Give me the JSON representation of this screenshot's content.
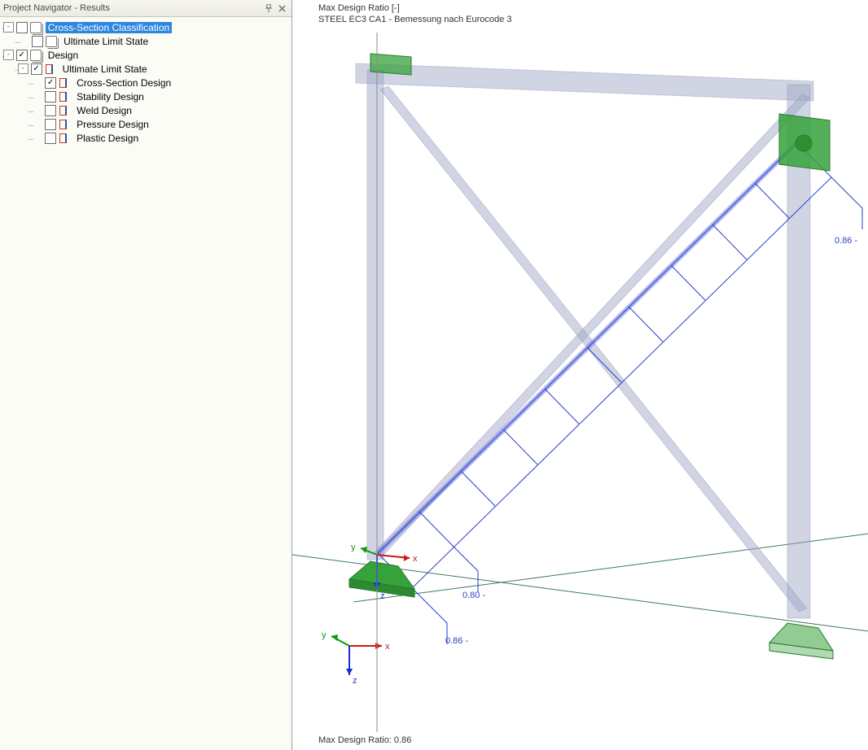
{
  "panel": {
    "title": "Project Navigator - Results",
    "pin_icon": "pin-icon",
    "close_icon": "close-icon"
  },
  "tree": {
    "root_a": {
      "label": "Cross-Section Classification"
    },
    "root_a_child": {
      "label": "Ultimate Limit State"
    },
    "root_b": {
      "label": "Design"
    },
    "root_b_uls": {
      "label": "Ultimate Limit State"
    },
    "items": [
      {
        "label": "Cross-Section Design",
        "checked": true
      },
      {
        "label": "Stability Design",
        "checked": false
      },
      {
        "label": "Weld Design",
        "checked": false
      },
      {
        "label": "Pressure Design",
        "checked": false
      },
      {
        "label": "Plastic Design",
        "checked": false
      }
    ]
  },
  "viewport": {
    "title_line1": "Max Design Ratio [-]",
    "title_line2": "STEEL EC3 CA1 - Bemessung nach Eurocode 3",
    "status": "Max Design Ratio: 0.86",
    "annotations": {
      "right": "0.86 -",
      "lower1": "0.80 -",
      "lower2": "0.86 -"
    },
    "axes": {
      "x": "x",
      "y": "y",
      "z": "z"
    }
  }
}
